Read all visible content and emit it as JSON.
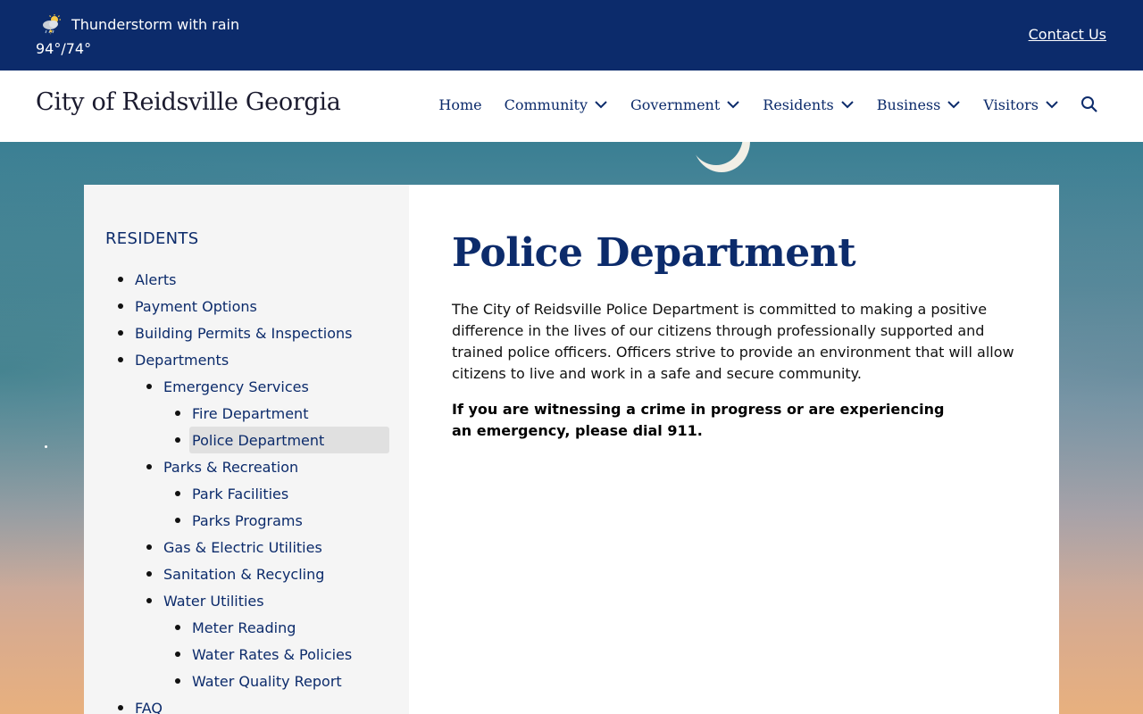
{
  "topbar": {
    "weather_condition": "Thunderstorm with rain",
    "weather_temp": "94°/74°",
    "weather_icon": "thunderstorm-icon",
    "contact_label": "Contact Us",
    "background_color": "#0c2b6b"
  },
  "header": {
    "site_title": "City of Reidsville Georgia",
    "nav": [
      {
        "label": "Home",
        "has_dropdown": false
      },
      {
        "label": "Community",
        "has_dropdown": true
      },
      {
        "label": "Government",
        "has_dropdown": true
      },
      {
        "label": "Residents",
        "has_dropdown": true
      },
      {
        "label": "Business",
        "has_dropdown": true
      },
      {
        "label": "Visitors",
        "has_dropdown": true
      }
    ],
    "search_icon": "search-icon"
  },
  "sidebar": {
    "title": "RESIDENTS",
    "items": [
      {
        "label": "Alerts",
        "level": 0
      },
      {
        "label": "Payment Options",
        "level": 0
      },
      {
        "label": "Building Permits & Inspections",
        "level": 0
      },
      {
        "label": "Departments",
        "level": 0
      },
      {
        "label": "Emergency Services",
        "level": 1
      },
      {
        "label": "Fire Department",
        "level": 2
      },
      {
        "label": "Police Department",
        "level": 2,
        "active": true
      },
      {
        "label": "Parks & Recreation",
        "level": 1
      },
      {
        "label": "Park Facilities",
        "level": 2
      },
      {
        "label": "Parks Programs",
        "level": 2
      },
      {
        "label": "Gas & Electric Utilities",
        "level": 1
      },
      {
        "label": "Sanitation & Recycling",
        "level": 1
      },
      {
        "label": "Water Utilities",
        "level": 1
      },
      {
        "label": "Meter Reading",
        "level": 2
      },
      {
        "label": "Water Rates & Policies",
        "level": 2
      },
      {
        "label": "Water Quality Report",
        "level": 2
      },
      {
        "label": "FAQ",
        "level": 0
      }
    ]
  },
  "main": {
    "title": "Police Department",
    "intro": "The City of Reidsville Police Department is committed to making a positive difference in the lives of our citizens through professionally supported and trained police officers. Officers strive to provide an environment that will allow citizens to live and work in a safe and secure community.",
    "emergency": "If you are witnessing a crime in progress or are experiencing an emergency, please dial 911."
  },
  "colors": {
    "brand_navy": "#0c2b6b",
    "sidebar_bg": "#f5f5f5",
    "active_item_bg": "#e0e0e0"
  }
}
